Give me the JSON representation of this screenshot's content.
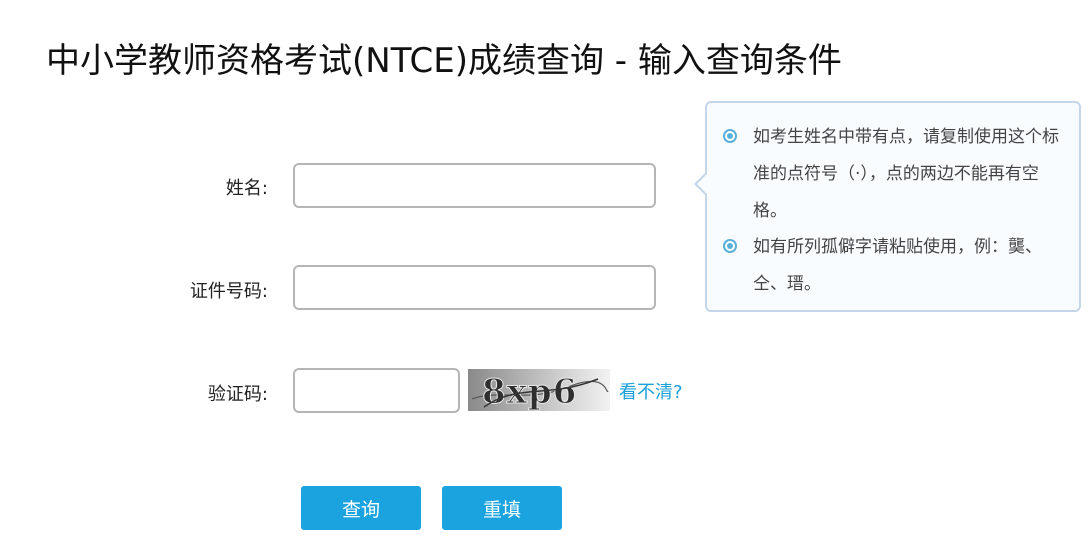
{
  "page": {
    "title": "中小学教师资格考试(NTCE)成绩查询 - 输入查询条件"
  },
  "form": {
    "name_label": "姓名:",
    "name_value": "",
    "id_label": "证件号码:",
    "id_value": "",
    "captcha_label": "验证码:",
    "captcha_value": "",
    "captcha_image_text": "8xp6",
    "captcha_refresh_label": "看不清?"
  },
  "buttons": {
    "query_label": "查询",
    "reset_label": "重填"
  },
  "tooltip": {
    "items": [
      {
        "text": "如考生姓名中带有点，请复制使用这个标准的点符号（·），点的两边不能再有空格。"
      },
      {
        "text": "如有所列孤僻字请粘贴使用，例：龑、仝、瑨。"
      }
    ]
  },
  "colors": {
    "accent": "#1aa3de",
    "link": "#1a9fd9",
    "tooltip_border": "#c5d6ea",
    "bullet": "#58b0d8"
  },
  "icons": {
    "tip_bullet": "radio-bullet-icon"
  }
}
